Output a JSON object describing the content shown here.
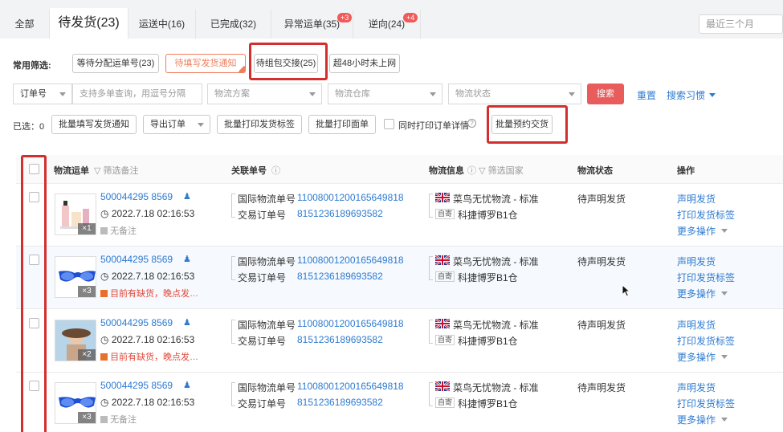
{
  "tabs": {
    "all": "全部",
    "pending": "待发货(23)",
    "shipping": "运送中(16)",
    "done": "已完成(32)",
    "abnormal": "异常运单(35)",
    "abnormal_badge": "+3",
    "reverse": "逆向(24)",
    "reverse_badge": "+4",
    "date_range": "最近三个月"
  },
  "filters": {
    "label": "常用筛选:",
    "chip1": "等待分配运单号(23)",
    "chip2": "待填写发货通知",
    "chip3": "待组包交接(25)",
    "chip4": "超48小时未上网"
  },
  "search": {
    "order_type": "订单号",
    "order_placeholder": "支持多单查询，用逗号分隔",
    "logistics_plan": "物流方案",
    "warehouse": "物流仓库",
    "status": "物流状态",
    "search_btn": "搜索",
    "reset": "重置",
    "habit": "搜索习惯"
  },
  "bulk": {
    "selected": "已选：0",
    "fill_notice": "批量填写发货通知",
    "export": "导出订单",
    "print_label": "批量打印发货标签",
    "print_sheet": "批量打印面单",
    "print_detail": "同时打印订单详情",
    "book_handover": "批量预约交货"
  },
  "columns": {
    "waybill": "物流运单",
    "waybill_filter": "筛选备注",
    "related": "关联单号",
    "logistics": "物流信息",
    "logistics_filter": "筛选国家",
    "status": "物流状态",
    "ops": "操作"
  },
  "rows": [
    {
      "waybill": "500044295 8569",
      "time": "2022.7.18 02:16:53",
      "note": "无备注",
      "note_warn": false,
      "qty": "×1",
      "intl_label": "国际物流单号",
      "intl_no": "1100800120016564981​8",
      "trade_label": "交易订单号",
      "trade_no": "8151236189693582",
      "carrier": "菜鸟无忧物流 - 标准",
      "tag": "自寄",
      "wh": "科捷博罗B1仓",
      "status": "待声明发货",
      "op1": "声明发货",
      "op2": "打印发货标签",
      "op3": "更多操作"
    },
    {
      "waybill": "500044295 8569",
      "time": "2022.7.18 02:16:53",
      "note": "目前有缺货，晚点发…",
      "note_warn": true,
      "qty": "×3",
      "intl_label": "国际物流单号",
      "intl_no": "1100800120016564981​8",
      "trade_label": "交易订单号",
      "trade_no": "8151236189693582",
      "carrier": "菜鸟无忧物流 - 标准",
      "tag": "自寄",
      "wh": "科捷博罗B1仓",
      "status": "待声明发货",
      "op1": "声明发货",
      "op2": "打印发货标签",
      "op3": "更多操作"
    },
    {
      "waybill": "500044295 8569",
      "time": "2022.7.18 02:16:53",
      "note": "目前有缺货，晚点发…",
      "note_warn": true,
      "qty": "×2",
      "intl_label": "国际物流单号",
      "intl_no": "1100800120016564981​8",
      "trade_label": "交易订单号",
      "trade_no": "8151236189693582",
      "carrier": "菜鸟无忧物流 - 标准",
      "tag": "自寄",
      "wh": "科捷博罗B1仓",
      "status": "待声明发货",
      "op1": "声明发货",
      "op2": "打印发货标签",
      "op3": "更多操作"
    },
    {
      "waybill": "500044295 8569",
      "time": "2022.7.18 02:16:53",
      "note": "无备注",
      "note_warn": false,
      "qty": "×3",
      "intl_label": "国际物流单号",
      "intl_no": "1100800120016564981​8",
      "trade_label": "交易订单号",
      "trade_no": "8151236189693582",
      "carrier": "菜鸟无忧物流 - 标准",
      "tag": "自寄",
      "wh": "科捷博罗B1仓",
      "status": "待声明发货",
      "op1": "声明发货",
      "op2": "打印发货标签",
      "op3": "更多操作"
    }
  ],
  "colors": {
    "accent": "#2e7bd0",
    "highlight": "#d32f2f",
    "search": "#e85c5c",
    "warn": "#e04a3c"
  }
}
